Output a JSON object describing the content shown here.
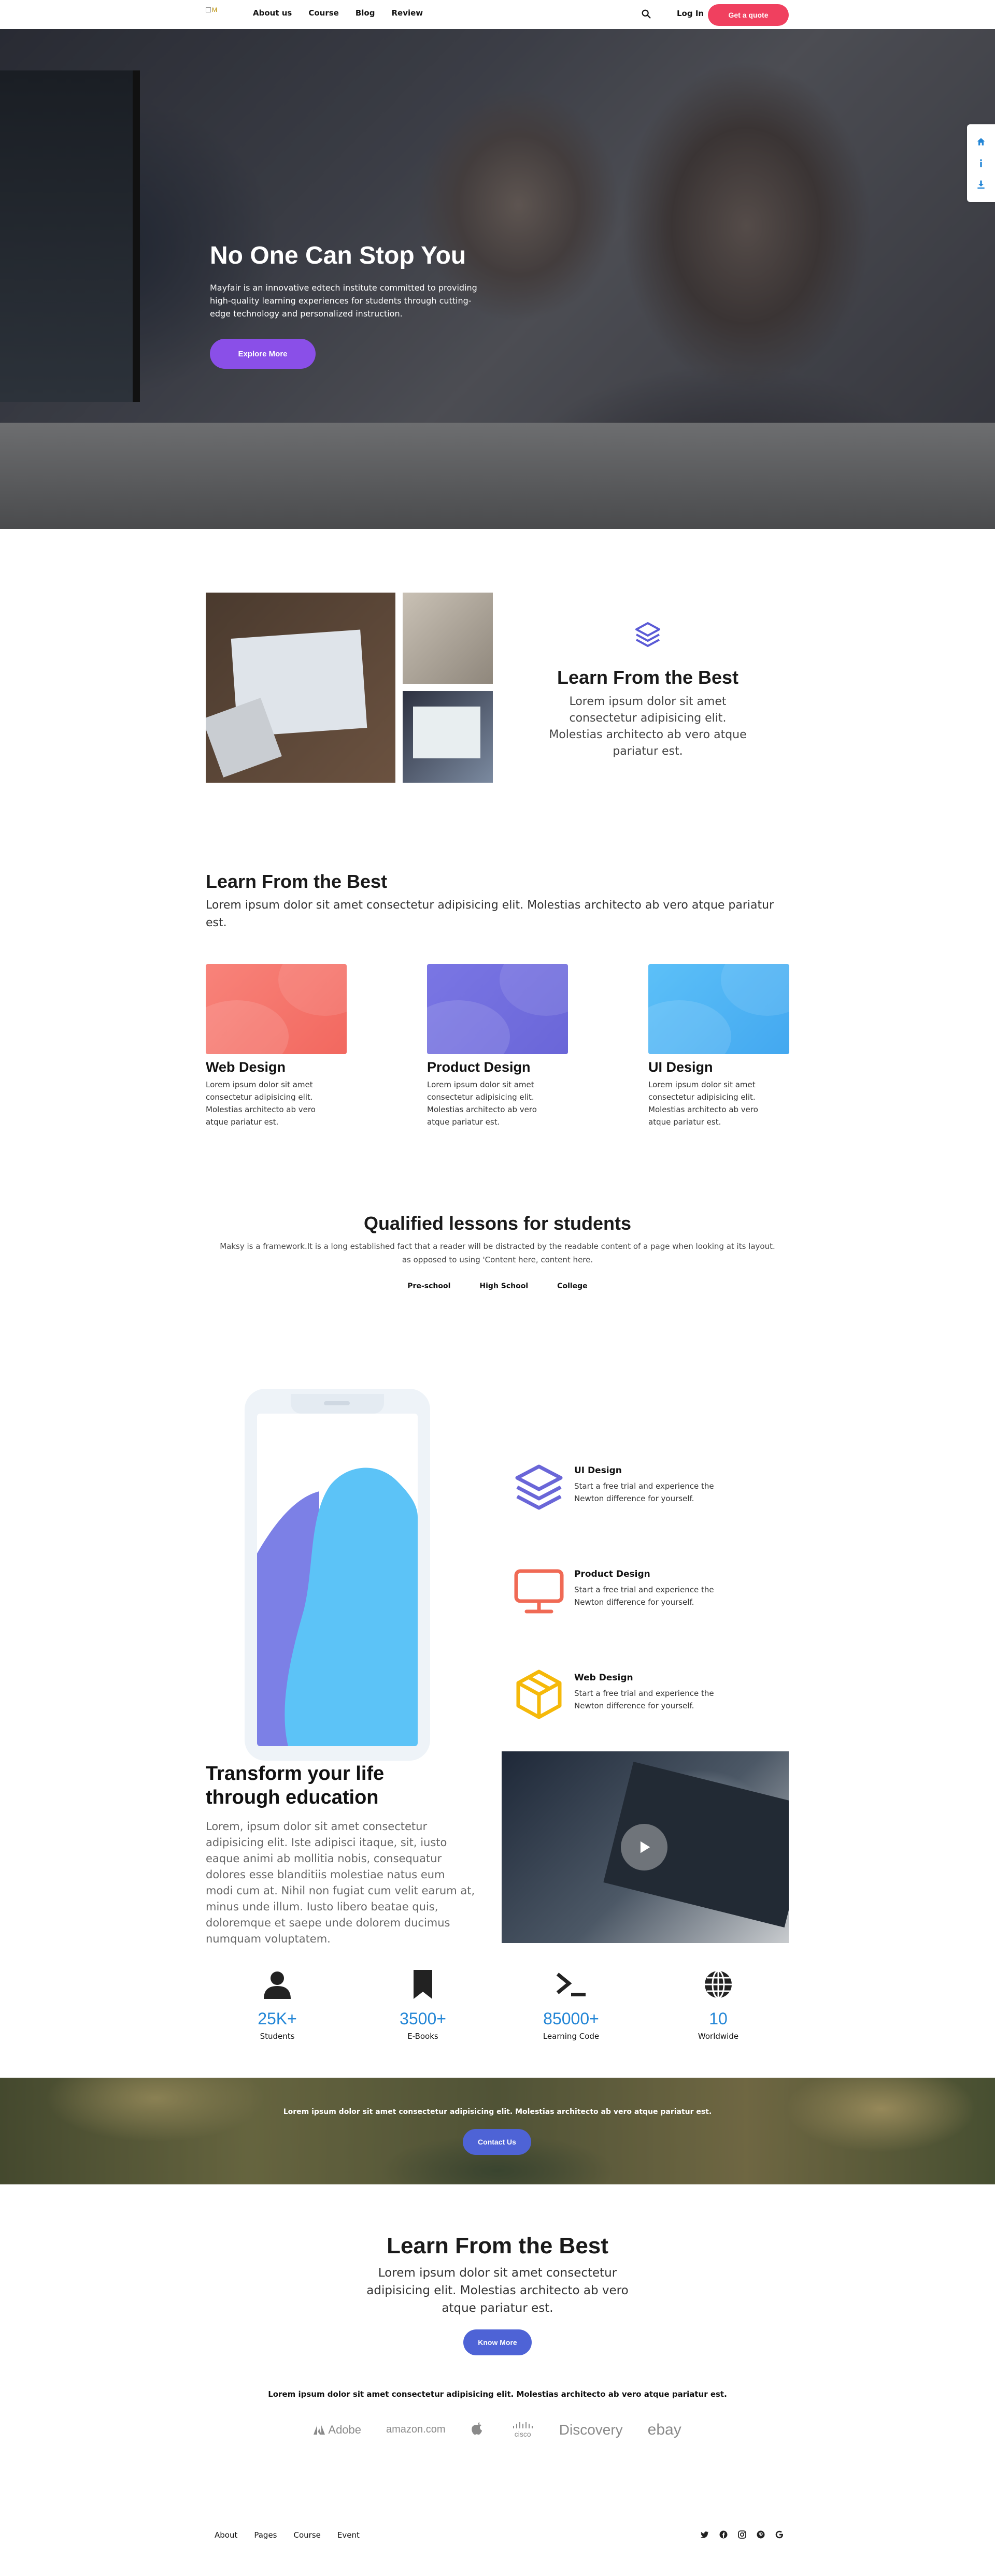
{
  "nav": {
    "logo_alt": "M",
    "links": [
      "About us",
      "Course",
      "Blog",
      "Review"
    ],
    "login": "Log In",
    "cta": "Get a quote"
  },
  "hero": {
    "title": "No One Can Stop You",
    "text": "Mayfair is an innovative edtech institute committed to providing high-quality learning experiences for students through cutting-edge technology and personalized instruction.",
    "button": "Explore More"
  },
  "side_toolbar": {
    "icons": [
      "home-icon",
      "info-icon",
      "download-icon"
    ]
  },
  "learn_best": {
    "icon": "layers-icon",
    "title": "Learn From the Best",
    "text": "Lorem ipsum dolor sit amet consectetur adipisicing elit. Molestias architecto ab vero atque pariatur est."
  },
  "courses": {
    "title": "Learn From the Best",
    "text": "Lorem ipsum dolor sit amet consectetur adipisicing elit. Molestias architecto ab vero atque pariatur est.",
    "cards": [
      {
        "title": "Web Design",
        "text": "Lorem ipsum dolor sit amet consectetur adipisicing elit. Molestias architecto ab vero atque pariatur est.",
        "color_from": "#f8837a",
        "color_to": "#f2685f"
      },
      {
        "title": "Product Design",
        "text": "Lorem ipsum dolor sit amet consectetur adipisicing elit. Molestias architecto ab vero atque pariatur est.",
        "color_from": "#7a76e4",
        "color_to": "#6a66d8"
      },
      {
        "title": "UI Design",
        "text": "Lorem ipsum dolor sit amet consectetur adipisicing elit. Molestias architecto ab vero atque pariatur est.",
        "color_from": "#5cc0f8",
        "color_to": "#43a8f0"
      }
    ]
  },
  "lessons": {
    "title": "Qualified lessons for students",
    "text": "Maksy is a framework.It is a long established fact that a reader will be distracted by the readable content of a page when looking at its layout. as opposed to using 'Content here, content here.",
    "tabs": [
      "Pre-school",
      "High School",
      "College"
    ]
  },
  "features": [
    {
      "icon": "layers-icon",
      "title": "UI Design",
      "text": "Start a free trial and experience the Newton difference for yourself.",
      "color": "#6a66d8"
    },
    {
      "icon": "monitor-icon",
      "title": "Product Design",
      "text": "Start a free trial and experience the Newton difference for yourself.",
      "color": "#f06a55"
    },
    {
      "icon": "box-icon",
      "title": "Web Design",
      "text": "Start a free trial and experience the Newton difference for yourself.",
      "color": "#f5b90a"
    }
  ],
  "transform": {
    "title": "Transform your life through education",
    "text": "Lorem, ipsum dolor sit amet consectetur adipisicing elit. Iste adipisci itaque, sit, iusto eaque animi ab mollitia nobis, consequatur dolores esse blanditiis molestiae natus eum modi cum at. Nihil non fugiat cum velit earum at, minus unde illum. Iusto libero beatae quis, doloremque et saepe unde dolorem ducimus numquam voluptatem."
  },
  "stats": [
    {
      "icon": "user-icon",
      "value": "25K+",
      "label": "Students"
    },
    {
      "icon": "bookmark-icon",
      "value": "3500+",
      "label": "E-Books"
    },
    {
      "icon": "terminal-icon",
      "value": "85000+",
      "label": "Learning Code"
    },
    {
      "icon": "globe-icon",
      "value": "10",
      "label": "Worldwide"
    }
  ],
  "banner": {
    "text": "Lorem ipsum dolor sit amet consectetur adipisicing elit. Molestias architecto ab vero atque pariatur est.",
    "button": "Contact Us"
  },
  "cta_section": {
    "title": "Learn From the Best",
    "text": "Lorem ipsum dolor sit amet consectetur adipisicing elit. Molestias architecto ab vero atque pariatur est.",
    "button": "Know More"
  },
  "partners": {
    "text": "Lorem ipsum dolor sit amet consectetur adipisicing elit. Molestias architecto ab vero atque pariatur est.",
    "logos": [
      "Adobe",
      "amazon.com",
      "",
      "cisco",
      "Discovery",
      "ebay"
    ]
  },
  "footer": {
    "links": [
      "About",
      "Pages",
      "Course",
      "Event"
    ],
    "social": [
      "twitter-icon",
      "facebook-icon",
      "instagram-icon",
      "pinterest-icon",
      "google-icon"
    ]
  },
  "colors": {
    "accent_pink": "#f0405f",
    "accent_purple": "#8a4fe8",
    "accent_blue": "#4e63d6",
    "stat_blue": "#2386d6"
  }
}
